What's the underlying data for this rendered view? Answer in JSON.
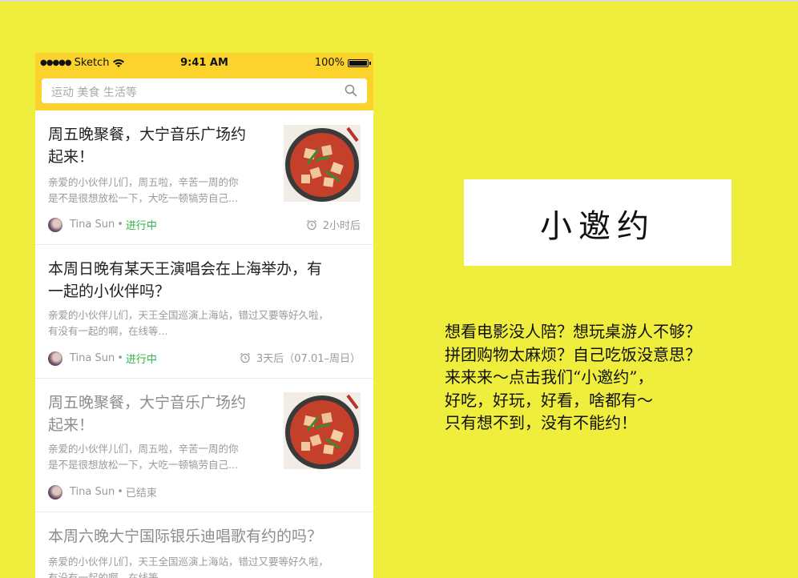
{
  "status_bar": {
    "carrier": "Sketch",
    "time": "9:41 AM",
    "battery": "100%"
  },
  "search": {
    "placeholder": "运动 美食 生活等"
  },
  "cards": [
    {
      "title_line1": "周五晚聚餐，大宁音乐广场约",
      "title_line2": "起来！",
      "desc_line1": "亲爱的小伙伴儿们，周五啦，辛苦一周的你",
      "desc_line2": "是不是很想放松一下，大吃一顿犒劳自己...",
      "author": "Tina Sun",
      "status": "进行中",
      "time": "2小时后"
    },
    {
      "title_line1": "本周日晚有某天王演唱会在上海举办，有",
      "title_line2": "一起的小伙伴吗？",
      "desc_line1": "亲爱的小伙伴儿们，天王全国巡演上海站，错过又要等好久啦，",
      "desc_line2": "有没有一起的啊，在线等...",
      "author": "Tina Sun",
      "status": "进行中",
      "time": "3天后（07.01–周日）"
    },
    {
      "title_line1": "周五晚聚餐，大宁音乐广场约",
      "title_line2": "起来！",
      "desc_line1": "亲爱的小伙伴儿们，周五啦，辛苦一周的你",
      "desc_line2": "是不是很想放松一下，大吃一顿犒劳自己...",
      "author": "Tina Sun",
      "status": "已结束"
    },
    {
      "title_line1": "本周六晚大宁国际银乐迪唱歌有约的吗？",
      "desc_line1": "亲爱的小伙伴儿们，天王全国巡演上海站，错过又要等好久啦，",
      "desc_line2": "有没有一起的啊，在线等..."
    }
  ],
  "logo": {
    "text": "小邀约"
  },
  "tagline": [
    "想看电影没人陪？想玩桌游人不够？",
    "拼团购物太麻烦？自己吃饭没意思？",
    "来来来～点击我们“小邀约”，",
    "好吃，好玩，好看，啥都有～",
    "只有想不到，没有不能约！"
  ],
  "colors": {
    "background": "#efee3c",
    "header": "#fcd22c",
    "status_active": "#2fb34a"
  }
}
